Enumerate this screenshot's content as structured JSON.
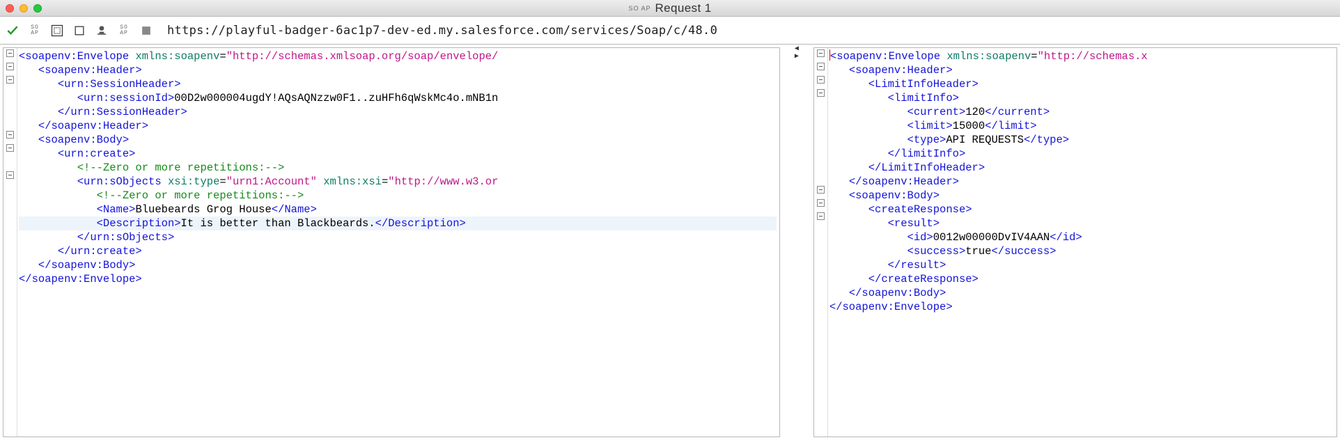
{
  "window": {
    "title": "Request 1",
    "app_glyph": "SO\nAP"
  },
  "toolbar": {
    "url": "https://playful-badger-6ac1p7-dev-ed.my.salesforce.com/services/Soap/c/48.0"
  },
  "request_xml": {
    "lines": [
      [
        {
          "t": "tag",
          "v": "<soapenv:Envelope"
        },
        {
          "t": "txt",
          "v": " "
        },
        {
          "t": "attr",
          "v": "xmlns:soapenv"
        },
        {
          "t": "txt",
          "v": "="
        },
        {
          "t": "str",
          "v": "\"http://schemas.xmlsoap.org/soap/envelope/"
        }
      ],
      [
        {
          "t": "txt",
          "v": "   "
        },
        {
          "t": "tag",
          "v": "<soapenv:Header>"
        }
      ],
      [
        {
          "t": "txt",
          "v": "      "
        },
        {
          "t": "tag",
          "v": "<urn:SessionHeader>"
        }
      ],
      [
        {
          "t": "txt",
          "v": "         "
        },
        {
          "t": "tag",
          "v": "<urn:sessionId>"
        },
        {
          "t": "txt",
          "v": "00D2w000004ugdY!AQsAQNzzw0F1..zuHFh6qWskMc4o.mNB1n"
        }
      ],
      [
        {
          "t": "txt",
          "v": "      "
        },
        {
          "t": "tag",
          "v": "</urn:SessionHeader>"
        }
      ],
      [
        {
          "t": "txt",
          "v": "   "
        },
        {
          "t": "tag",
          "v": "</soapenv:Header>"
        }
      ],
      [
        {
          "t": "txt",
          "v": "   "
        },
        {
          "t": "tag",
          "v": "<soapenv:Body>"
        }
      ],
      [
        {
          "t": "txt",
          "v": "      "
        },
        {
          "t": "tag",
          "v": "<urn:create>"
        }
      ],
      [
        {
          "t": "txt",
          "v": "         "
        },
        {
          "t": "cmt",
          "v": "<!--Zero or more repetitions:-->"
        }
      ],
      [
        {
          "t": "txt",
          "v": "         "
        },
        {
          "t": "tag",
          "v": "<urn:sObjects"
        },
        {
          "t": "txt",
          "v": " "
        },
        {
          "t": "attr",
          "v": "xsi:type"
        },
        {
          "t": "txt",
          "v": "="
        },
        {
          "t": "str",
          "v": "\"urn1:Account\""
        },
        {
          "t": "txt",
          "v": " "
        },
        {
          "t": "attr",
          "v": "xmlns:xsi"
        },
        {
          "t": "txt",
          "v": "="
        },
        {
          "t": "str",
          "v": "\"http://www.w3.or"
        }
      ],
      [
        {
          "t": "txt",
          "v": "            "
        },
        {
          "t": "cmt",
          "v": "<!--Zero or more repetitions:-->"
        }
      ],
      [
        {
          "t": "txt",
          "v": "            "
        },
        {
          "t": "tag",
          "v": "<Name>"
        },
        {
          "t": "txt",
          "v": "Bluebeards Grog House"
        },
        {
          "t": "tag",
          "v": "</Name>"
        }
      ],
      [
        {
          "t": "txt",
          "v": "            "
        },
        {
          "t": "tag",
          "v": "<Description>"
        },
        {
          "t": "txt",
          "v": "It is better than Blackbeards."
        },
        {
          "t": "tag",
          "v": "</Description>"
        }
      ],
      [
        {
          "t": "txt",
          "v": "         "
        },
        {
          "t": "tag",
          "v": "</urn:sObjects>"
        }
      ],
      [
        {
          "t": "txt",
          "v": "      "
        },
        {
          "t": "tag",
          "v": "</urn:create>"
        }
      ],
      [
        {
          "t": "txt",
          "v": "   "
        },
        {
          "t": "tag",
          "v": "</soapenv:Body>"
        }
      ],
      [
        {
          "t": "tag",
          "v": "</soapenv:Envelope>"
        }
      ]
    ],
    "gutter": [
      "minus",
      "minus",
      "minus",
      "",
      "",
      "",
      "minus",
      "minus",
      "",
      "minus",
      "",
      "",
      "",
      "",
      "",
      "",
      ""
    ],
    "highlight_line": 12
  },
  "response_xml": {
    "lines": [
      [
        {
          "t": "tag",
          "v": "<soapenv:Envelope"
        },
        {
          "t": "txt",
          "v": " "
        },
        {
          "t": "attr",
          "v": "xmlns:soapenv"
        },
        {
          "t": "txt",
          "v": "="
        },
        {
          "t": "str",
          "v": "\"http://schemas.x"
        }
      ],
      [
        {
          "t": "txt",
          "v": "   "
        },
        {
          "t": "tag",
          "v": "<soapenv:Header>"
        }
      ],
      [
        {
          "t": "txt",
          "v": "      "
        },
        {
          "t": "tag",
          "v": "<LimitInfoHeader>"
        }
      ],
      [
        {
          "t": "txt",
          "v": "         "
        },
        {
          "t": "tag",
          "v": "<limitInfo>"
        }
      ],
      [
        {
          "t": "txt",
          "v": "            "
        },
        {
          "t": "tag",
          "v": "<current>"
        },
        {
          "t": "txt",
          "v": "120"
        },
        {
          "t": "tag",
          "v": "</current>"
        }
      ],
      [
        {
          "t": "txt",
          "v": "            "
        },
        {
          "t": "tag",
          "v": "<limit>"
        },
        {
          "t": "txt",
          "v": "15000"
        },
        {
          "t": "tag",
          "v": "</limit>"
        }
      ],
      [
        {
          "t": "txt",
          "v": "            "
        },
        {
          "t": "tag",
          "v": "<type>"
        },
        {
          "t": "txt",
          "v": "API REQUESTS"
        },
        {
          "t": "tag",
          "v": "</type>"
        }
      ],
      [
        {
          "t": "txt",
          "v": "         "
        },
        {
          "t": "tag",
          "v": "</limitInfo>"
        }
      ],
      [
        {
          "t": "txt",
          "v": "      "
        },
        {
          "t": "tag",
          "v": "</LimitInfoHeader>"
        }
      ],
      [
        {
          "t": "txt",
          "v": "   "
        },
        {
          "t": "tag",
          "v": "</soapenv:Header>"
        }
      ],
      [
        {
          "t": "txt",
          "v": "   "
        },
        {
          "t": "tag",
          "v": "<soapenv:Body>"
        }
      ],
      [
        {
          "t": "txt",
          "v": "      "
        },
        {
          "t": "tag",
          "v": "<createResponse>"
        }
      ],
      [
        {
          "t": "txt",
          "v": "         "
        },
        {
          "t": "tag",
          "v": "<result>"
        }
      ],
      [
        {
          "t": "txt",
          "v": "            "
        },
        {
          "t": "tag",
          "v": "<id>"
        },
        {
          "t": "txt",
          "v": "0012w00000DvIV4AAN"
        },
        {
          "t": "tag",
          "v": "</id>"
        }
      ],
      [
        {
          "t": "txt",
          "v": "            "
        },
        {
          "t": "tag",
          "v": "<success>"
        },
        {
          "t": "txt",
          "v": "true"
        },
        {
          "t": "tag",
          "v": "</success>"
        }
      ],
      [
        {
          "t": "txt",
          "v": "         "
        },
        {
          "t": "tag",
          "v": "</result>"
        }
      ],
      [
        {
          "t": "txt",
          "v": "      "
        },
        {
          "t": "tag",
          "v": "</createResponse>"
        }
      ],
      [
        {
          "t": "txt",
          "v": "   "
        },
        {
          "t": "tag",
          "v": "</soapenv:Body>"
        }
      ],
      [
        {
          "t": "tag",
          "v": "</soapenv:Envelope>"
        }
      ]
    ],
    "gutter": [
      "minus",
      "minus",
      "minus",
      "minus",
      "",
      "",
      "",
      "",
      "",
      "",
      "minus",
      "minus",
      "minus",
      "",
      "",
      "",
      "",
      "",
      ""
    ],
    "caret_line": 0
  }
}
